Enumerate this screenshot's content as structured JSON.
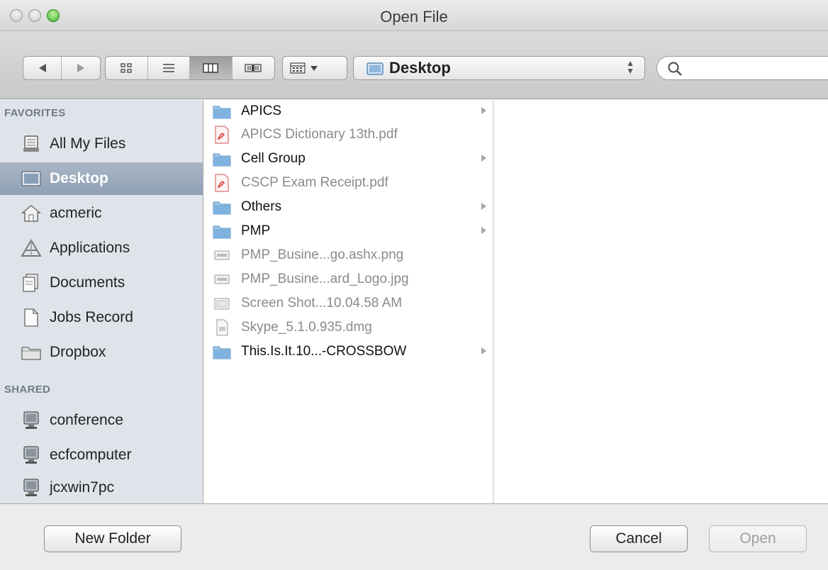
{
  "window": {
    "title": "Open File"
  },
  "toolbar": {
    "location": "Desktop",
    "search_placeholder": ""
  },
  "sidebar": {
    "favorites_header": "FAVORITES",
    "favorites": [
      {
        "label": "All My Files",
        "icon": "all-files-icon"
      },
      {
        "label": "Desktop",
        "icon": "desktop-icon",
        "selected": true
      },
      {
        "label": "acmeric",
        "icon": "home-icon"
      },
      {
        "label": "Applications",
        "icon": "applications-icon"
      },
      {
        "label": "Documents",
        "icon": "documents-icon"
      },
      {
        "label": "Jobs Record",
        "icon": "document-icon"
      },
      {
        "label": "Dropbox",
        "icon": "folder-icon"
      }
    ],
    "shared_header": "SHARED",
    "shared": [
      {
        "label": "conference",
        "icon": "computer-icon"
      },
      {
        "label": "ecfcomputer",
        "icon": "computer-icon"
      },
      {
        "label": "jcxwin7pc",
        "icon": "computer-icon"
      }
    ]
  },
  "files": [
    {
      "name": "APICS",
      "type": "folder"
    },
    {
      "name": "APICS Dictionary 13th.pdf",
      "type": "pdf"
    },
    {
      "name": "Cell Group",
      "type": "folder"
    },
    {
      "name": "CSCP Exam Receipt.pdf",
      "type": "pdf"
    },
    {
      "name": "Others",
      "type": "folder"
    },
    {
      "name": "PMP",
      "type": "folder"
    },
    {
      "name": "PMP_Busine...go.ashx.png",
      "type": "image"
    },
    {
      "name": "PMP_Busine...ard_Logo.jpg",
      "type": "image"
    },
    {
      "name": "Screen Shot...10.04.58 AM",
      "type": "screenshot"
    },
    {
      "name": "Skype_5.1.0.935.dmg",
      "type": "dmg"
    },
    {
      "name": "This.Is.It.10...-CROSSBOW",
      "type": "folder"
    }
  ],
  "buttons": {
    "new_folder": "New Folder",
    "cancel": "Cancel",
    "open": "Open"
  },
  "colors": {
    "sidebar_bg": "#dfe4ea",
    "selection": "#98a8bc",
    "folder": "#6fa8d8"
  }
}
